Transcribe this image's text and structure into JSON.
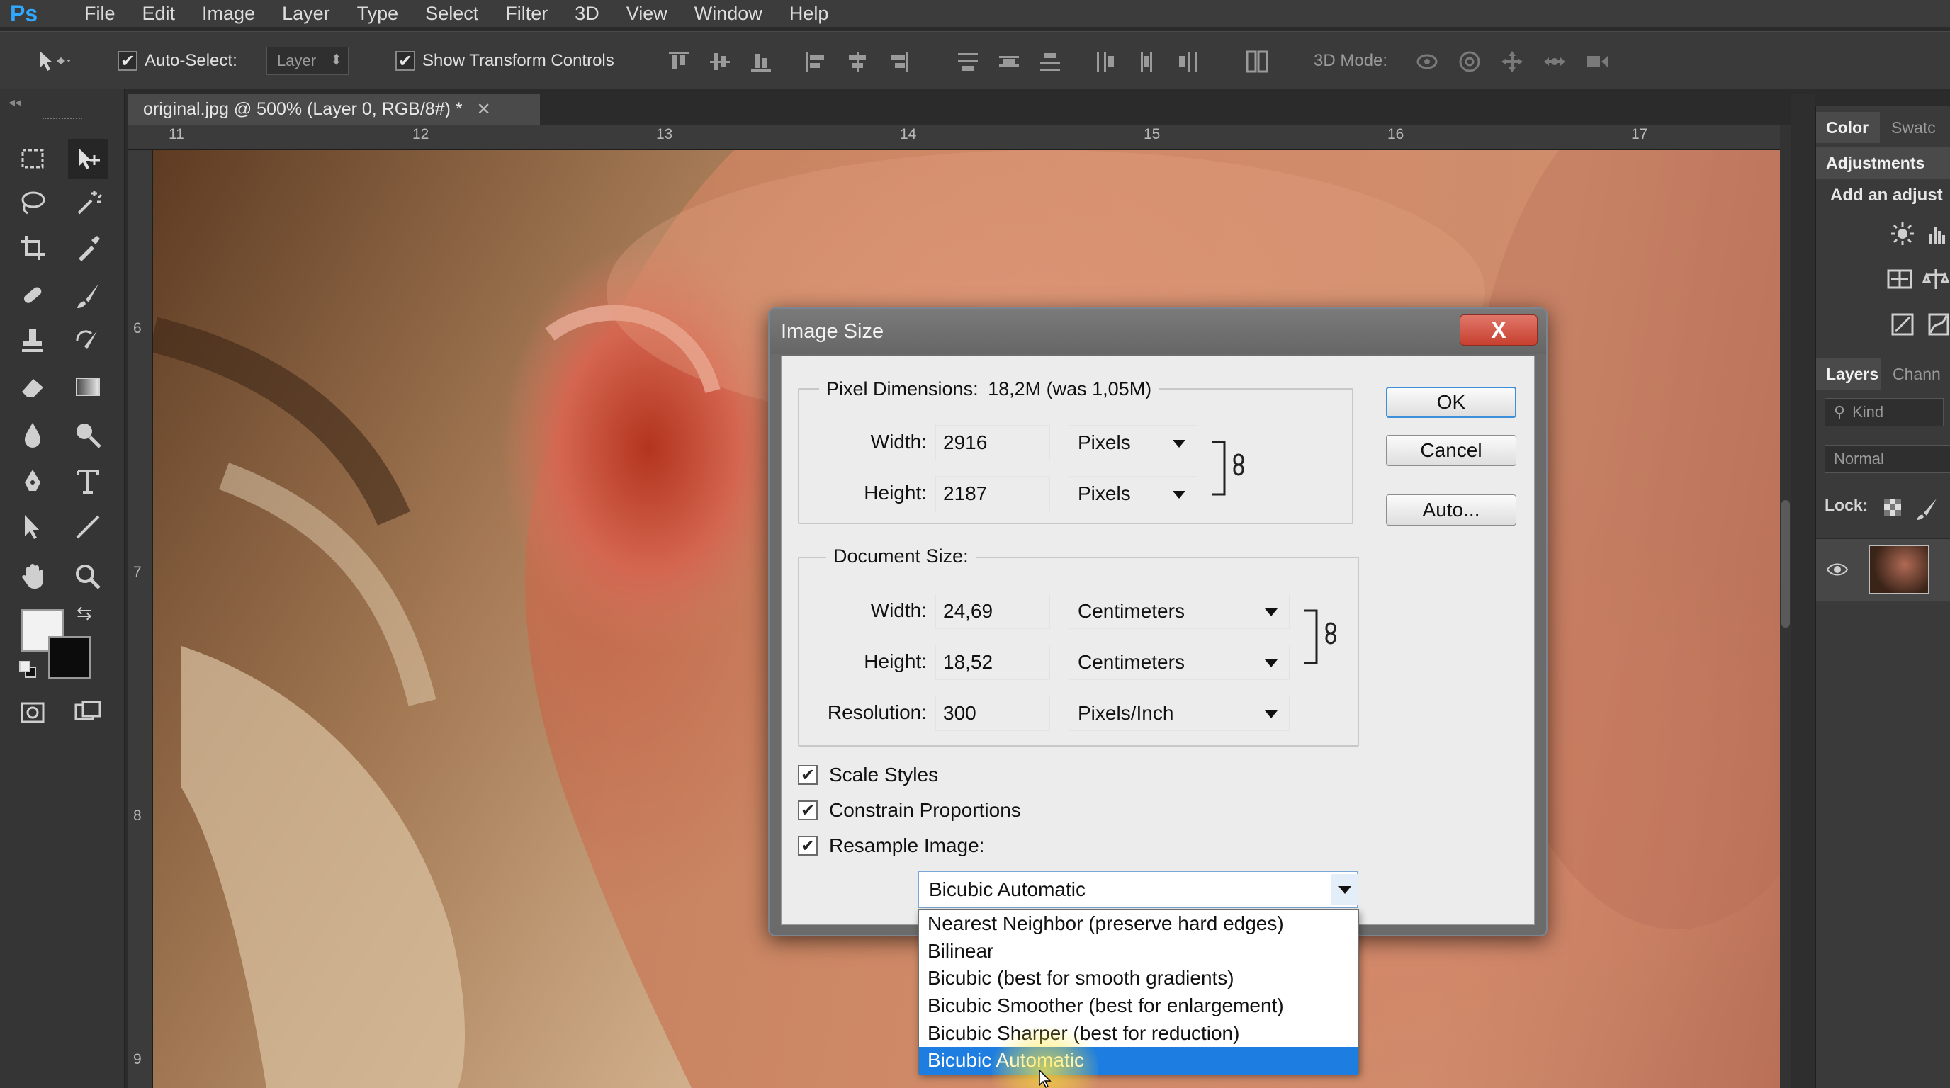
{
  "menubar": {
    "logo": "Ps",
    "items": [
      "File",
      "Edit",
      "Image",
      "Layer",
      "Type",
      "Select",
      "Filter",
      "3D",
      "View",
      "Window",
      "Help"
    ]
  },
  "options": {
    "auto_select_label": "Auto-Select:",
    "auto_select_checked": true,
    "auto_select_target": "Layer",
    "show_transform_label": "Show Transform Controls",
    "show_transform_checked": true,
    "mode_3d_label": "3D Mode:"
  },
  "document": {
    "tab_title": "original.jpg @ 500% (Layer 0, RGB/8#) *",
    "ruler_top": [
      "11",
      "12",
      "13",
      "14",
      "15",
      "16",
      "17"
    ],
    "ruler_left": [
      "6",
      "7",
      "8",
      "9"
    ]
  },
  "panels": {
    "color_tab": "Color",
    "swatches_tab": "Swatc",
    "adjustments_tab": "Adjustments",
    "add_adjustment": "Add an adjust",
    "layers_tab": "Layers",
    "channels_tab": "Chann",
    "kind_label": "Kind",
    "blend_mode": "Normal",
    "lock_label": "Lock:"
  },
  "dialog": {
    "title": "Image Size",
    "close": "X",
    "pixel_dimensions_label": "Pixel Dimensions:",
    "pixel_dimensions_value": "18,2M (was 1,05M)",
    "pixel": {
      "width_label": "Width:",
      "width_value": "2916",
      "width_unit": "Pixels",
      "height_label": "Height:",
      "height_value": "2187",
      "height_unit": "Pixels"
    },
    "document_size_label": "Document Size:",
    "docsize": {
      "width_label": "Width:",
      "width_value": "24,69",
      "width_unit": "Centimeters",
      "height_label": "Height:",
      "height_value": "18,52",
      "height_unit": "Centimeters",
      "resolution_label": "Resolution:",
      "resolution_value": "300",
      "resolution_unit": "Pixels/Inch"
    },
    "buttons": {
      "ok": "OK",
      "cancel": "Cancel",
      "auto": "Auto..."
    },
    "checkboxes": {
      "scale_styles": "Scale Styles",
      "constrain_proportions": "Constrain Proportions",
      "resample_image": "Resample Image:"
    },
    "resample_method": "Bicubic Automatic",
    "resample_options": [
      "Nearest Neighbor (preserve hard edges)",
      "Bilinear",
      "Bicubic (best for smooth gradients)",
      "Bicubic Smoother (best for enlargement)",
      "Bicubic Sharper (best for reduction)",
      "Bicubic Automatic"
    ],
    "resample_selected_index": 5
  },
  "colors": {
    "accent": "#1d7de0",
    "foreground_swatch": "#f2f2f2",
    "background_swatch": "#0c0c0c",
    "close_button": "#c7402f"
  }
}
